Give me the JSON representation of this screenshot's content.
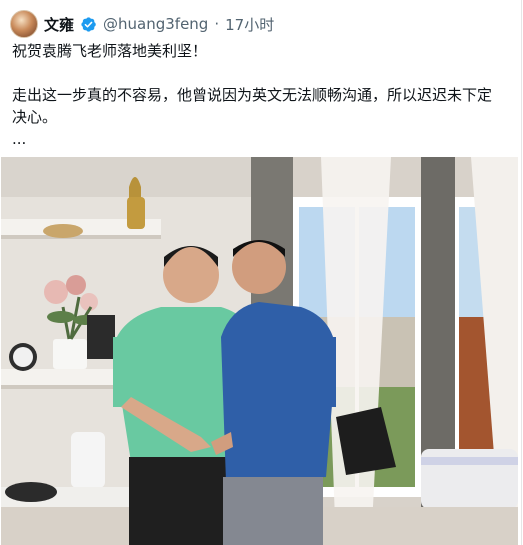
{
  "tweet": {
    "author_name": "文雍",
    "handle": "@huang3feng",
    "separator": "·",
    "time": "17小时",
    "lines": [
      "祝贺袁腾飞老师落地美利坚！",
      "走出这一步真的不容易，他曾说因为英文无法顺畅沟通，所以迟迟未下定",
      "决心。",
      "..."
    ]
  },
  "photo": {
    "description_icon": "photo-two-men-handshake"
  },
  "colors": {
    "verified_blue": "#1d9bf0",
    "secondary_text": "#536471"
  }
}
